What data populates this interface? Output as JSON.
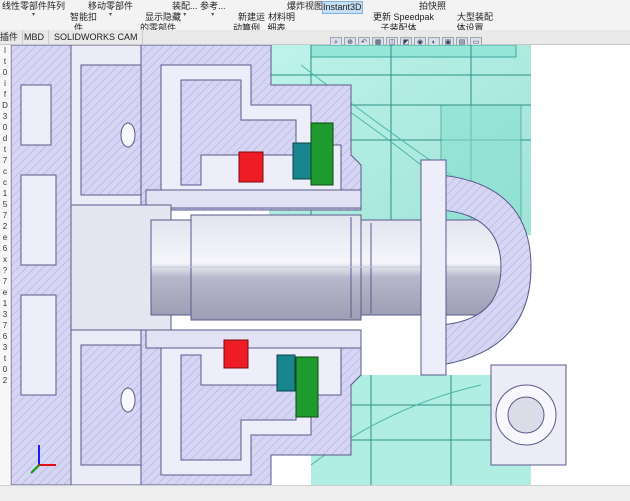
{
  "ribbon": {
    "items": [
      {
        "label": "线性零部件阵列"
      },
      {
        "label": "智能扣\n件"
      },
      {
        "label": "移动零部件"
      },
      {
        "label": "显示隐藏\n的零部件"
      },
      {
        "label": "装配..."
      },
      {
        "label": "参考..."
      },
      {
        "label": "新建运\n动算例"
      },
      {
        "label": "材料明\n细表"
      },
      {
        "label": "爆炸视图"
      },
      {
        "label": "Instant3D"
      },
      {
        "label": "更新 Speedpak\n子装配体"
      },
      {
        "label": "拍快照"
      },
      {
        "label": "大型装配\n体设置"
      }
    ]
  },
  "tabs": [
    {
      "label": "插件"
    },
    {
      "label": "MBD"
    },
    {
      "label": "SOLIDWORKS CAM"
    }
  ],
  "feature_tree_glyphs": [
    "l",
    "t",
    "0",
    "i",
    "f",
    "D",
    "3",
    "0",
    "d",
    "t",
    "7",
    "c",
    "c",
    "1",
    "5",
    "7",
    "2",
    "e",
    "6",
    "x",
    "?",
    "7",
    "e",
    "1",
    "3",
    "7",
    "6",
    "3",
    "t",
    "0",
    "2"
  ],
  "colors": {
    "red_part": "#ee1c24",
    "green_part": "#1e9a2e",
    "teal_part": "#17868e",
    "transparent_housing": "#86e3d5",
    "section_hatch": "#c8c8ee",
    "shaft": "#cfcfe0"
  }
}
